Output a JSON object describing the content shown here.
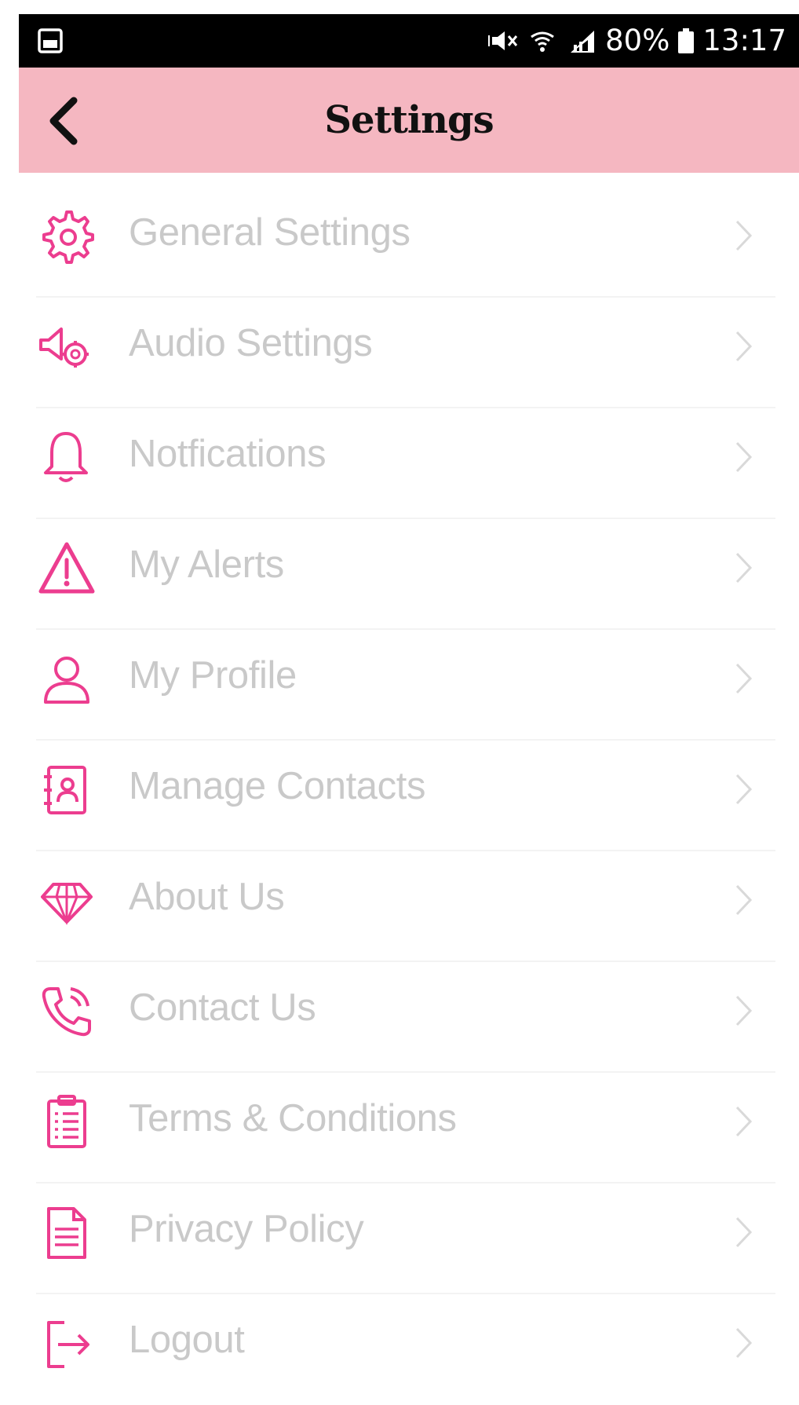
{
  "status_bar": {
    "battery": "80%",
    "time": "13:17",
    "icons": [
      "gallery-icon",
      "mute-icon",
      "wifi-icon",
      "signal-icon",
      "battery-icon"
    ]
  },
  "header": {
    "title": "Settings",
    "back_icon": "back-chevron-icon",
    "background_color": "#f5b7c1"
  },
  "accent_color": "#ec3d8f",
  "menu": {
    "items": [
      {
        "label": "General Settings",
        "icon": "gear-icon"
      },
      {
        "label": "Audio Settings",
        "icon": "speaker-gear-icon"
      },
      {
        "label": "Notfications",
        "icon": "bell-icon"
      },
      {
        "label": "My Alerts",
        "icon": "warning-icon"
      },
      {
        "label": "My Profile",
        "icon": "user-icon"
      },
      {
        "label": "Manage Contacts",
        "icon": "contact-book-icon"
      },
      {
        "label": "About Us",
        "icon": "diamond-icon"
      },
      {
        "label": "Contact Us",
        "icon": "phone-icon"
      },
      {
        "label": "Terms & Conditions",
        "icon": "clipboard-icon"
      },
      {
        "label": "Privacy Policy",
        "icon": "document-icon"
      },
      {
        "label": "Logout",
        "icon": "logout-icon"
      }
    ]
  }
}
